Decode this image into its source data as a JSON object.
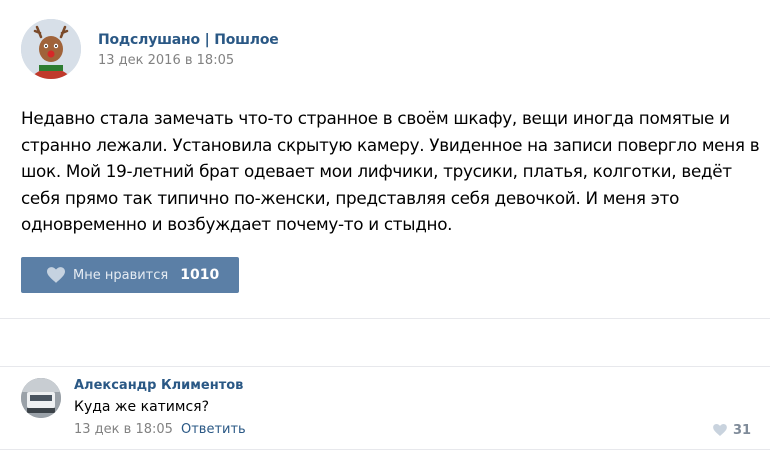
{
  "post": {
    "author": "Подслушано | Пошлое",
    "date": "13 дек 2016 в 18:05",
    "text": "Недавно стала замечать что-то странное в своём шкафу, вещи иногда помятые и странно лежали. Установила скрытую камеру. Увиденное на записи повергло меня в шок. Мой 19-летний брат одевает мои лифчики, трусики, платья, колготки, ведёт себя прямо так типично по-женски, представляя себя девочкой. И меня это одновременно и возбуждает почему-то и стыдно.",
    "avatar_icon": "reindeer-avatar",
    "like": {
      "label": "Мне нравится",
      "count": "1010",
      "icon": "heart-icon"
    }
  },
  "comment": {
    "author": "Александр Климентов",
    "text": "Куда же катимся?",
    "date": "13 дек в 18:05",
    "reply_label": "Ответить",
    "like_count": "31",
    "like_icon": "heart-icon"
  },
  "colors": {
    "link": "#2a5885",
    "like_button_bg": "#5b7fa6",
    "muted": "#828282",
    "divider": "#e7e8ec"
  }
}
